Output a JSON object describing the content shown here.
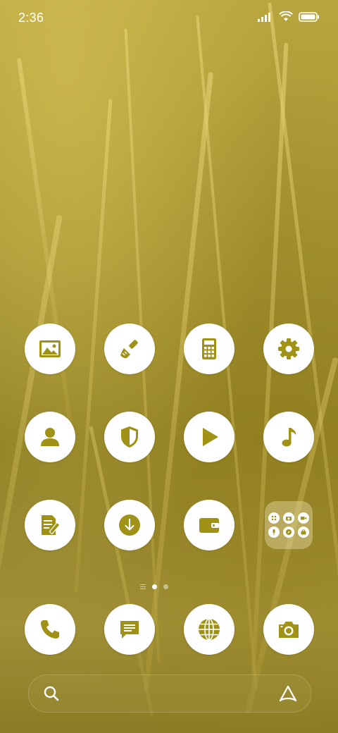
{
  "status_bar": {
    "time": "2:36",
    "icons": [
      "signal-icon",
      "wifi-icon",
      "battery-icon"
    ]
  },
  "theme": {
    "icon_color": "#a09216",
    "icon_background": "#ffffff"
  },
  "home_grid": [
    {
      "name": "gallery",
      "icon": "image-icon"
    },
    {
      "name": "themes",
      "icon": "paintbrush-icon"
    },
    {
      "name": "calculator",
      "icon": "calculator-icon"
    },
    {
      "name": "settings",
      "icon": "gear-icon"
    },
    {
      "name": "contacts",
      "icon": "person-icon"
    },
    {
      "name": "security",
      "icon": "shield-icon"
    },
    {
      "name": "play-store",
      "icon": "play-icon"
    },
    {
      "name": "music",
      "icon": "music-note-icon"
    },
    {
      "name": "notes",
      "icon": "note-edit-icon"
    },
    {
      "name": "downloads",
      "icon": "download-icon"
    },
    {
      "name": "wallet",
      "icon": "wallet-icon"
    },
    {
      "name": "folder",
      "icon": "folder-icon",
      "contents": [
        "grid-icon",
        "camera-icon",
        "video-icon",
        "mic-icon",
        "compass-icon",
        "bag-icon"
      ]
    }
  ],
  "page_indicator": {
    "pages": 2,
    "active": 1,
    "has_feed_page": true
  },
  "dock": [
    {
      "name": "phone",
      "icon": "phone-icon"
    },
    {
      "name": "messages",
      "icon": "message-icon"
    },
    {
      "name": "browser",
      "icon": "globe-icon"
    },
    {
      "name": "camera",
      "icon": "camera-icon"
    }
  ],
  "search_bar": {
    "left_icon": "search-icon",
    "right_icon": "assistant-icon"
  }
}
